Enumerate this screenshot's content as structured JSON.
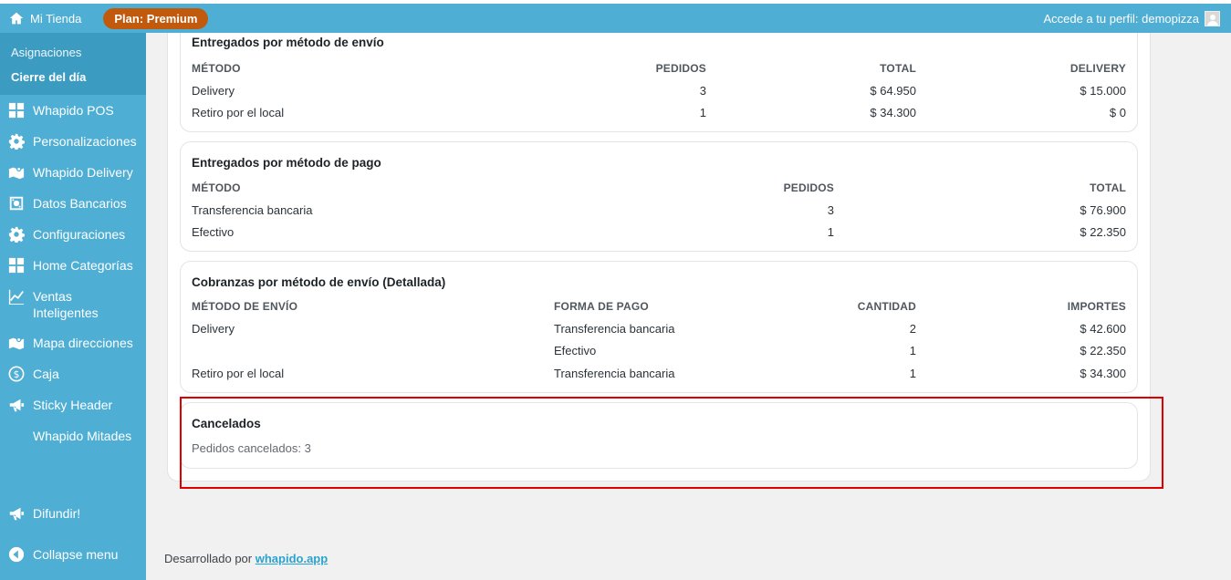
{
  "topbar": {
    "home_label": "Mi Tienda",
    "plan_badge": "Plan: Premium",
    "profile_text": "Accede a tu perfil: demopizza"
  },
  "sidebar": {
    "submenu": [
      {
        "label": "Asignaciones"
      },
      {
        "label": "Cierre del día"
      }
    ],
    "items": [
      {
        "label": "Whapido POS",
        "icon": "grid-icon"
      },
      {
        "label": "Personalizaciones",
        "icon": "gear-icon"
      },
      {
        "label": "Whapido Delivery",
        "icon": "map-icon"
      },
      {
        "label": "Datos Bancarios",
        "icon": "bank-icon"
      },
      {
        "label": "Configuraciones",
        "icon": "gear-icon"
      },
      {
        "label": "Home Categorías",
        "icon": "grid-icon"
      },
      {
        "label": "Ventas Inteligentes",
        "icon": "chart-line-icon"
      },
      {
        "label": "Mapa direcciones",
        "icon": "map-icon"
      },
      {
        "label": "Caja",
        "icon": "dollar-circle-icon"
      },
      {
        "label": "Sticky Header",
        "icon": "megaphone-icon"
      },
      {
        "label": "Whapido Mitades",
        "icon": ""
      }
    ],
    "difundir": "Difundir!",
    "collapse": "Collapse menu"
  },
  "envio": {
    "title": "Entregados por método de envío",
    "headers": [
      "MÉTODO",
      "PEDIDOS",
      "TOTAL",
      "DELIVERY"
    ],
    "rows": [
      [
        "Delivery",
        "3",
        "$ 64.950",
        "$ 15.000"
      ],
      [
        "Retiro por el local",
        "1",
        "$ 34.300",
        "$ 0"
      ]
    ]
  },
  "pago": {
    "title": "Entregados por método de pago",
    "headers": [
      "MÉTODO",
      "PEDIDOS",
      "TOTAL"
    ],
    "rows": [
      [
        "Transferencia bancaria",
        "3",
        "$ 76.900"
      ],
      [
        "Efectivo",
        "1",
        "$ 22.350"
      ]
    ]
  },
  "cobranzas": {
    "title": "Cobranzas por método de envío (Detallada)",
    "headers": [
      "MÉTODO DE ENVÍO",
      "FORMA DE PAGO",
      "CANTIDAD",
      "IMPORTES"
    ],
    "rows": [
      [
        "Delivery",
        "Transferencia bancaria",
        "2",
        "$ 42.600"
      ],
      [
        "",
        "Efectivo",
        "1",
        "$ 22.350"
      ],
      [
        "Retiro por el local",
        "Transferencia bancaria",
        "1",
        "$ 34.300"
      ]
    ]
  },
  "cancelados": {
    "title": "Cancelados",
    "text": "Pedidos cancelados: 3"
  },
  "footer": {
    "prefix": "Desarrollado por",
    "link": "whapido.app"
  },
  "colors": {
    "sidebar": "#4eaed3",
    "badge": "#c15a0d",
    "highlight": "#e00000"
  }
}
